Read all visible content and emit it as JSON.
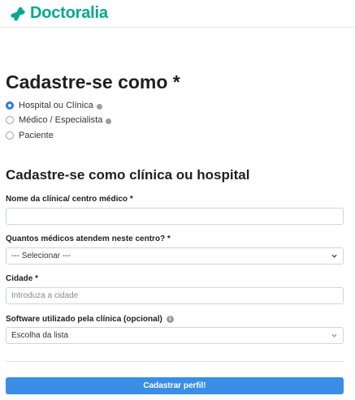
{
  "brand": {
    "name": "Doctoralia",
    "color": "#00a98f"
  },
  "title": "Cadastre-se como *",
  "account_types": [
    {
      "label": "Hospital ou Clínica",
      "selected": true,
      "has_info": true
    },
    {
      "label": "Médico / Especialista",
      "selected": false,
      "has_info": true
    },
    {
      "label": "Paciente",
      "selected": false,
      "has_info": false
    }
  ],
  "section_title": "Cadastre-se como clínica ou hospital",
  "form": {
    "clinic_name": {
      "label": "Nome da clínica/ centro médico *",
      "value": ""
    },
    "doctor_count": {
      "label": "Quantos médicos atendem neste centro? *",
      "value": "--- Selecionar ---"
    },
    "city": {
      "label": "Cidade *",
      "placeholder": "Introduza a cidade"
    },
    "software": {
      "label": "Software utilizado pela clínica (opcional)",
      "value": "Escolha da lista"
    }
  },
  "submit_label": "Cadastrar perfil!",
  "accent_color": "#3a8ee6"
}
